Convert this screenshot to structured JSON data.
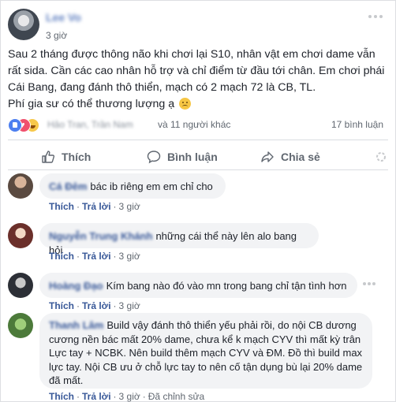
{
  "post": {
    "author": "Lee Vo",
    "time": "3 giờ",
    "text_line1": "Sau 2 tháng được thông não khi chơi lại S10, nhân vật em chơi dame vẫn rất sida. Cần các cao nhân hỗ trợ và chỉ điểm từ đầu tới chân. Em chơi phái Cái Bang, đang đánh thô thiển, mạch có 2 mạch 72 là CB, TL.",
    "text_line2": "Phí gia sư có thể thương lượng ạ",
    "reaction_names": "Hảo Tran, Trần Nam",
    "reaction_others": "và 11 người khác",
    "comment_count": "17 bình luận"
  },
  "actions": {
    "like": "Thích",
    "comment": "Bình luận",
    "share": "Chia sẻ"
  },
  "comments": [
    {
      "author": "Cá Đêm",
      "text": "bác ib riêng em em chỉ cho",
      "like": "Thích",
      "reply": "Trả lời",
      "time": "3 giờ"
    },
    {
      "author": "Nguyễn Trung Khánh",
      "text": "những cái thể này lên alo bang hỏi",
      "like": "Thích",
      "reply": "Trả lời",
      "time": "3 giờ"
    },
    {
      "author": "Hoàng Đạo",
      "text": "Kím bang nào đó vào mn trong bang chỉ tận tình hơn",
      "like": "Thích",
      "reply": "Trả lời",
      "time": "3 giờ"
    },
    {
      "author": "Thanh Lâm",
      "text": "Build vậy đánh thô thiển yếu phải rồi, do nội CB dương cương nền bác mất 20% dame, chưa kể k mạch CYV thì mất kỳ trân Lực tay + NCBK. Nên build thêm mạch CYV và ĐM. Đồ thì build max lực tay. Nội CB ưu ở chỗ lực tay to nên cố tận dụng bù lại 20% dame đã mất.",
      "like": "Thích",
      "reply": "Trả lời",
      "time": "3 giờ",
      "edited": "Đã chỉnh sửa"
    }
  ],
  "colors": {
    "link": "#385898",
    "meta": "#606770",
    "bubble": "#f2f3f5",
    "like_blue": "#4d7ff0",
    "love_red": "#f0506e",
    "haha_yellow": "#f7c84b"
  },
  "icons": [
    "more-options-icon",
    "like-reaction-icon",
    "love-reaction-icon",
    "haha-reaction-icon",
    "thumbs-up-icon",
    "speech-bubble-icon",
    "share-arrow-icon",
    "loading-icon",
    "sad-emoji-icon"
  ]
}
